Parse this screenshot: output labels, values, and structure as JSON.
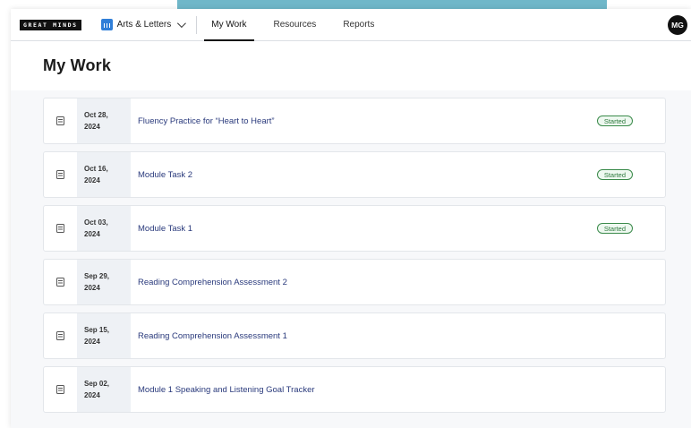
{
  "header": {
    "logo_text": "GREAT MINDS",
    "product_name": "Arts & Letters",
    "nav": [
      {
        "label": "My Work",
        "active": true
      },
      {
        "label": "Resources",
        "active": false
      },
      {
        "label": "Reports",
        "active": false
      }
    ],
    "avatar_initials": "MG"
  },
  "page": {
    "title": "My Work"
  },
  "work_items": [
    {
      "date_line1": "Oct 28,",
      "date_line2": "2024",
      "title": "Fluency Practice for “Heart to Heart”",
      "status": "Started",
      "icon": "document-lines-icon"
    },
    {
      "date_line1": "Oct 16,",
      "date_line2": "2024",
      "title": "Module Task 2",
      "status": "Started",
      "icon": "document-icon"
    },
    {
      "date_line1": "Oct 03,",
      "date_line2": "2024",
      "title": "Module Task 1",
      "status": "Started",
      "icon": "document-icon"
    },
    {
      "date_line1": "Sep 29,",
      "date_line2": "2024",
      "title": "Reading Comprehension Assessment 2",
      "status": "",
      "icon": "document-icon"
    },
    {
      "date_line1": "Sep 15,",
      "date_line2": "2024",
      "title": "Reading Comprehension Assessment 1",
      "status": "",
      "icon": "document-icon"
    },
    {
      "date_line1": "Sep 02,",
      "date_line2": "2024",
      "title": "Module 1 Speaking and Listening Goal Tracker",
      "status": "",
      "icon": "document-lines-icon"
    }
  ],
  "colors": {
    "accent_bar": "#6fb7c9",
    "link_title": "#2a3a7c",
    "status_green": "#2e7a3e",
    "date_cell_bg": "#eef1f5"
  }
}
